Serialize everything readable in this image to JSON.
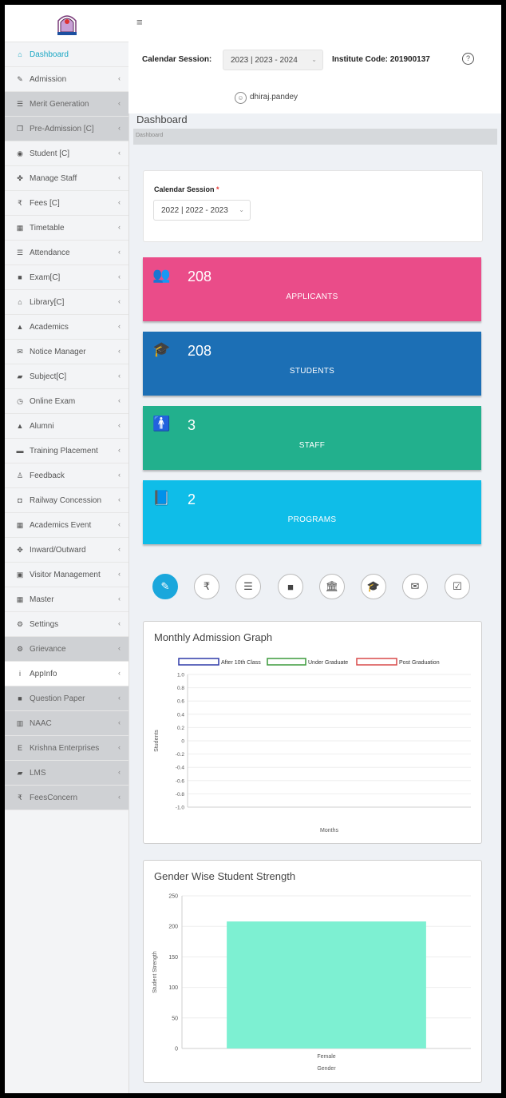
{
  "sidebar": {
    "items": [
      {
        "icon": "home-icon",
        "glyph": "⌂",
        "label": "Dashboard",
        "style": "active",
        "chev": false
      },
      {
        "icon": "edit-icon",
        "glyph": "✎",
        "label": "Admission",
        "style": "",
        "chev": true
      },
      {
        "icon": "list-icon",
        "glyph": "☰",
        "label": "Merit Generation",
        "style": "gray",
        "chev": true
      },
      {
        "icon": "copy-icon",
        "glyph": "❐",
        "label": "Pre-Admission [C]",
        "style": "gray",
        "chev": true
      },
      {
        "icon": "user-circle-icon",
        "glyph": "◉",
        "label": "Student [C]",
        "style": "",
        "chev": true
      },
      {
        "icon": "group-icon",
        "glyph": "✤",
        "label": "Manage Staff",
        "style": "",
        "chev": true
      },
      {
        "icon": "rupee-icon",
        "glyph": "₹",
        "label": "Fees [C]",
        "style": "",
        "chev": true
      },
      {
        "icon": "calendar-icon",
        "glyph": "▦",
        "label": "Timetable",
        "style": "",
        "chev": true
      },
      {
        "icon": "list-icon",
        "glyph": "☰",
        "label": "Attendance",
        "style": "",
        "chev": true
      },
      {
        "icon": "sticky-note-icon",
        "glyph": "■",
        "label": "Exam[C]",
        "style": "",
        "chev": true
      },
      {
        "icon": "bank-icon",
        "glyph": "⌂",
        "label": "Library[C]",
        "style": "",
        "chev": true
      },
      {
        "icon": "graduation-cap-icon",
        "glyph": "▲",
        "label": "Academics",
        "style": "",
        "chev": true
      },
      {
        "icon": "envelope-icon",
        "glyph": "✉",
        "label": "Notice Manager",
        "style": "",
        "chev": true
      },
      {
        "icon": "book-icon",
        "glyph": "▰",
        "label": "Subject[C]",
        "style": "",
        "chev": true
      },
      {
        "icon": "clock-icon",
        "glyph": "◷",
        "label": "Online Exam",
        "style": "",
        "chev": true
      },
      {
        "icon": "graduation-cap-icon",
        "glyph": "▲",
        "label": "Alumni",
        "style": "",
        "chev": true
      },
      {
        "icon": "briefcase-icon",
        "glyph": "▬",
        "label": "Training Placement",
        "style": "",
        "chev": true
      },
      {
        "icon": "person-icon",
        "glyph": "♙",
        "label": "Feedback",
        "style": "",
        "chev": true
      },
      {
        "icon": "train-icon",
        "glyph": "◘",
        "label": "Railway Concession",
        "style": "",
        "chev": true
      },
      {
        "icon": "calendar-icon",
        "glyph": "▦",
        "label": "Academics Event",
        "style": "",
        "chev": true
      },
      {
        "icon": "arrows-icon",
        "glyph": "✥",
        "label": "Inward/Outward",
        "style": "",
        "chev": true
      },
      {
        "icon": "id-card-icon",
        "glyph": "▣",
        "label": "Visitor Management",
        "style": "",
        "chev": true
      },
      {
        "icon": "grid-icon",
        "glyph": "▦",
        "label": "Master",
        "style": "",
        "chev": true
      },
      {
        "icon": "gears-icon",
        "glyph": "⚙",
        "label": "Settings",
        "style": "",
        "chev": true
      },
      {
        "icon": "gear-icon",
        "glyph": "⚙",
        "label": "Grievance",
        "style": "gray",
        "chev": true
      },
      {
        "icon": "info-icon",
        "glyph": "i",
        "label": "AppInfo",
        "style": "white",
        "chev": true
      },
      {
        "icon": "sticky-note-icon",
        "glyph": "■",
        "label": "Question Paper",
        "style": "gray",
        "chev": true
      },
      {
        "icon": "bar-chart-icon",
        "glyph": "▥",
        "label": "NAAC",
        "style": "gray",
        "chev": true
      },
      {
        "icon": "letter-e-icon",
        "glyph": "E",
        "label": "Krishna Enterprises",
        "style": "gray",
        "chev": true
      },
      {
        "icon": "book-icon",
        "glyph": "▰",
        "label": "LMS",
        "style": "gray",
        "chev": true
      },
      {
        "icon": "rupee-icon",
        "glyph": "₹",
        "label": "FeesConcern",
        "style": "gray",
        "chev": true
      }
    ],
    "chevron_glyph": "‹"
  },
  "topbar": {
    "menu_glyph": "≡"
  },
  "session_bar": {
    "label": "Calendar Session:",
    "value": "2023 | 2023 - 2024",
    "institute_code": "Institute Code: 201900137",
    "help_glyph": "?"
  },
  "user": {
    "name": "dhiraj.pandey",
    "avatar_glyph": "☺"
  },
  "page": {
    "title": "Dashboard",
    "breadcrumb": "Dashboard"
  },
  "session_card": {
    "label": "Calendar Session",
    "required": "*",
    "value": "2022 | 2022 - 2023"
  },
  "stats": [
    {
      "name": "applicants",
      "icon": "users-icon",
      "glyph": "👥",
      "value": "208",
      "label": "APPLICANTS",
      "color": "#ea4c89"
    },
    {
      "name": "students",
      "icon": "graduation-cap-icon",
      "glyph": "🎓",
      "value": "208",
      "label": "STUDENTS",
      "color": "#1c6fb5"
    },
    {
      "name": "staff",
      "icon": "male-icon",
      "glyph": "🚹",
      "value": "3",
      "label": "STAFF",
      "color": "#22b08d"
    },
    {
      "name": "programs",
      "icon": "book-icon",
      "glyph": "📘",
      "value": "2",
      "label": "PROGRAMS",
      "color": "#0fbde8"
    }
  ],
  "quick_icons": [
    {
      "name": "edit-icon",
      "glyph": "✎"
    },
    {
      "name": "rupee-icon",
      "glyph": "₹"
    },
    {
      "name": "list-icon",
      "glyph": "☰"
    },
    {
      "name": "sticky-note-icon",
      "glyph": "■"
    },
    {
      "name": "bank-icon",
      "glyph": "🏛"
    },
    {
      "name": "graduation-cap-icon",
      "glyph": "🎓"
    },
    {
      "name": "envelope-icon",
      "glyph": "✉"
    },
    {
      "name": "calendar-check-icon",
      "glyph": "☑"
    }
  ],
  "chart_data": [
    {
      "type": "line",
      "title": "Monthly Admission Graph",
      "xlabel": "Months",
      "ylabel": "Students",
      "ylim": [
        -1.0,
        1.0
      ],
      "yticks": [
        "1.0",
        "0.8",
        "0.6",
        "0.4",
        "0.2",
        "0",
        "-0.2",
        "-0.4",
        "-0.6",
        "-0.8",
        "-1.0"
      ],
      "categories": [],
      "series": [
        {
          "name": "After 10th Class",
          "values": [],
          "color": "#2f3aa8"
        },
        {
          "name": "Under Graduate",
          "values": [],
          "color": "#3c9a3c"
        },
        {
          "name": "Post Graduation",
          "values": [],
          "color": "#d94a4a"
        }
      ],
      "legend": "top",
      "grid": true
    },
    {
      "type": "bar",
      "title": "Gender Wise Student Strength",
      "xlabel": "Gender",
      "ylabel": "Student Strength",
      "categories": [
        "Female"
      ],
      "values": [
        208
      ],
      "ylim": [
        0,
        250
      ],
      "yticks": [
        "250",
        "200",
        "150",
        "100",
        "50",
        "0"
      ],
      "color": "#7df0d2",
      "grid": true
    }
  ]
}
